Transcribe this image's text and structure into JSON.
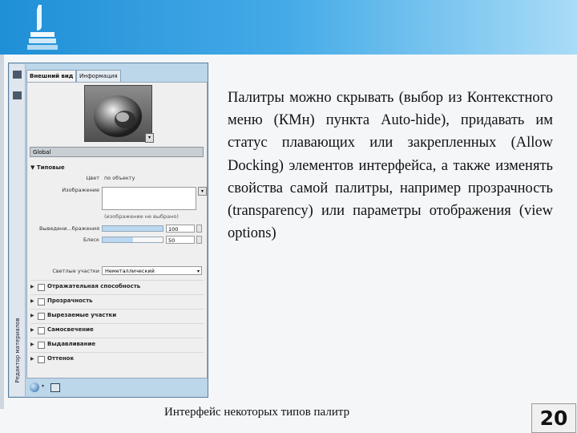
{
  "palette": {
    "tabs": [
      "Внешний вид",
      "Информация"
    ],
    "global_label": "Global",
    "section_title": "Типовые",
    "color_label": "Цвет",
    "color_value": "по объекту",
    "image_label": "Изображение",
    "image_hint": "(изображение не выбрано)",
    "fade_label": "Выведени...бражения",
    "fade_value": "100",
    "fade_level": 1.0,
    "gloss_label": "Блеск",
    "gloss_value": "50",
    "gloss_level": 0.5,
    "highlights_label": "Светлые участки",
    "highlights_value": "Неметаллический",
    "collapsed_sections": [
      "Отражательная способность",
      "Прозрачность",
      "Вырезаемые участки",
      "Самосвечение",
      "Выдавливание",
      "Оттенок"
    ],
    "vertical_title": "Редактор материалов",
    "icons": [
      "material-sphere-icon",
      "material-ball-icon",
      "dropdown-arrow-icon",
      "panel-icon"
    ]
  },
  "body_text": "Палитры можно скрывать (выбор из Контекстного меню (КМн) пункта Auto-hide), придавать им статус плавающих или закрепленных (Allow Docking) элементов интерфейса, а также изменять свойства самой палитры, например прозрачность (transparency) или параметры отображения (view options)",
  "caption": "Интерфейс некоторых типов палитр",
  "page_number": "20",
  "colors": {
    "header_start": "#1f8fd6",
    "header_end": "#a9dcf6"
  }
}
